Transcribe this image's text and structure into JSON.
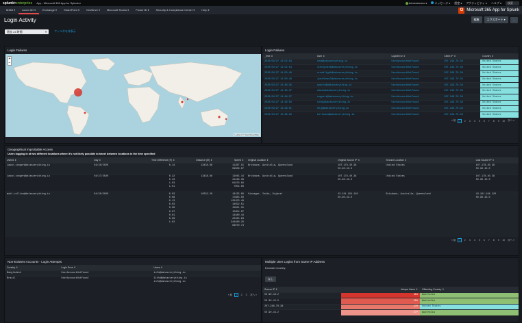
{
  "topbar": {
    "brand_splunk": "splunk>",
    "brand_enterprise": "enterprise",
    "app_label": "App : Microsoft 365 App for Splunk ▾",
    "admin": "Administrator ▾",
    "messages": "メッセージ ▾",
    "settings": "設定 ▾",
    "activity": "アクティビティ ▾",
    "help": "ヘルプ ▾",
    "find": "検索"
  },
  "appbar": {
    "menus": [
      "M365 ▾",
      "Azure AD ▾",
      "Exchange ▾",
      "SharePoint ▾",
      "OneDrive ▾",
      "Microsoft Teams ▾",
      "Power BI ▾",
      "Security & Compliance Center ▾",
      "Help ▾"
    ],
    "logo": "O",
    "app_name": "Microsoft 365 App for Splunk"
  },
  "page": {
    "title": "Login Activity",
    "edit": "編集",
    "export": "エクスポート ▾",
    "more": "..."
  },
  "inputs": {
    "time_range": "過去 24 時間",
    "time_caret": "▾",
    "hide_filters": "フィルタを非表示"
  },
  "login_failures_map": {
    "title": "Login Failures",
    "zoom_in": "+",
    "zoom_out": "−",
    "attribution": "Leaflet | © OpenStreetMap"
  },
  "login_failures_table": {
    "title": "Login Failures",
    "columns": [
      "_time ⇕",
      "User ⇕",
      "LoginError ⇕",
      "Client IP ⇕",
      "Country ⇕"
    ],
    "rows": [
      [
        "2020/04/27 14:52:54",
        "ceo@datasverything.io",
        "UserAccountNotFound",
        "207.246.70.38",
        "United States"
      ],
      [
        "2020/04/27 14:52:54",
        "ithelpdesk@datasverything.io",
        "UserAccountNotFound",
        "207.246.70.38",
        "United States"
      ],
      [
        "2020/04/27 14:50:48",
        "crowdlight@datasverything.io",
        "UserAccountNotFound",
        "207.246.70.38",
        "United States"
      ],
      [
        "2020/04/27 14:50:48",
        "jsmithmail@datasverything.io",
        "UserAccountNotFound",
        "207.246.70.38",
        "United States"
      ],
      [
        "2020/04/27 14:48:36",
        "sparck@datasverything.io",
        "UserAccountNotFound",
        "207.246.70.38",
        "United States"
      ],
      [
        "2020/04/27 14:46:37",
        "admin@datasverything.io",
        "UserAccountNotFound",
        "207.246.70.38",
        "United States"
      ],
      [
        "2020/04/27 14:46:37",
        "support@datasverything.io",
        "UserAccountNotFound",
        "207.246.70.38",
        "United States"
      ],
      [
        "2020/04/27 14:36:56",
        "cosby@datasverything.io",
        "UserAccountNotFound",
        "207.246.70.38",
        "United States"
      ],
      [
        "2020/04/27 14:36:51",
        "help@datasverything.io",
        "UserAccountNotFound",
        "207.246.70.38",
        "United States"
      ],
      [
        "2020/04/27 14:36:18",
        "billomon@datasverything.io",
        "UserAccountNotFound",
        "207.246.70.38",
        "United States"
      ]
    ],
    "pager": {
      "prev": "« 前",
      "pages": [
        "1",
        "2",
        "3",
        "4",
        "5",
        "6",
        "7",
        "8",
        "9",
        "10"
      ],
      "next": "次へ »"
    }
  },
  "geo": {
    "title": "Geographical Improbable Access",
    "description": "Users logging in at two different locations where it's not likely possible to travel between locations in the time specified",
    "columns": [
      "UserId ⇕",
      "Day ⇕",
      "Time Difference (H) ⇕",
      "Distance (M) ⇕",
      "Speed ⇕",
      "Original Location ⇕",
      "Original Source IP ⇕",
      "Second Location ⇕",
      "Last Source IP ⇕"
    ],
    "rows": [
      {
        "user": "jason.conger@datasverything.io",
        "day": "04/28/2020",
        "tdiff": "0.14",
        "dist": "13438.86",
        "speed": "11287.15\n59506.07",
        "oloc": "Brisbane, Australia, Queensland",
        "oip": "107.178.40.38\n50.90.43.0",
        "sloc": "United States",
        "lip": "107.178.40.38\n50.90.43.0"
      },
      {
        "user": "jason.conger@datasverything.io",
        "day": "04/27/2020",
        "tdiff": "0.32\n0.43\n1.03\n1.01",
        "dist": "13438.86",
        "speed": "13045.44\n31248.38\n61876.09\n7054.06",
        "oloc": "Brisbane, Australia, Queensland",
        "oip": "107.178.40.38\n50.90.43.0",
        "sloc": "United States",
        "lip": "107.178.40.38\n50.90.43.0"
      },
      {
        "user": "matt.collins@datasverything.io",
        "day": "04/28/2020",
        "tdiff": "0.03\n0.08\n0.13\n0.03\n0.06\n0.07\n0.01\n0.09\n1.02",
        "dist": "10332.20",
        "speed": "10135.00\n17885.50\n120153.48\n14552.51\n15821.31\n15654.87\n14480.44\n22325.93\n344480.29\n64070.74",
        "oloc": "Visnagar, India, Gujarat",
        "oip": "43.241.194.120\n50.90.43.0",
        "sloc": "Brisbane, Australia, Queensland",
        "lip": "43.241.194.120\n50.90.43.0"
      }
    ],
    "pager": {
      "prev": "« 前",
      "pages": [
        "1",
        "2",
        "3",
        "4",
        "5",
        "6",
        "7",
        "8",
        "9",
        "10"
      ],
      "next": "次へ »"
    }
  },
  "nonexistent": {
    "title": "Non-Existent Accounts - Login Attempts",
    "columns": [
      "Country ⇕",
      "Login Error ⇕",
      "Users ⇕"
    ],
    "rows": [
      [
        "Bangladesh",
        "UserAccountNotFound",
        "info@datasverything.io"
      ],
      [
        "Brazil",
        "UserAccountNotFound",
        "1ithd@datasverything.io\ninfo@datasverything.io"
      ]
    ],
    "pager": {
      "prev": "« 前",
      "pages": [
        "1",
        "2",
        "3"
      ],
      "next": "次へ »"
    }
  },
  "multi": {
    "title": "Multiple User Logins from Same IP Address",
    "exclude_label": "Exclude Country:",
    "exclude_value": "なし",
    "columns": [
      "Source IP ⇕",
      "Unique Users ⇕",
      "Offending Country ⇕"
    ],
    "rows": [
      [
        "50.90.43.2",
        "384",
        "Australia"
      ],
      [
        "50.90.42.0",
        "281",
        "Australia"
      ],
      [
        "207.246.70.38",
        "270",
        "United States"
      ],
      [
        "50.90.43.2",
        "1??",
        "Australia"
      ]
    ]
  },
  "colors": {
    "accent": "#1a9dd9",
    "cyan": "#86e0e0",
    "red": "#d6352e",
    "green": "#8fbf72"
  }
}
